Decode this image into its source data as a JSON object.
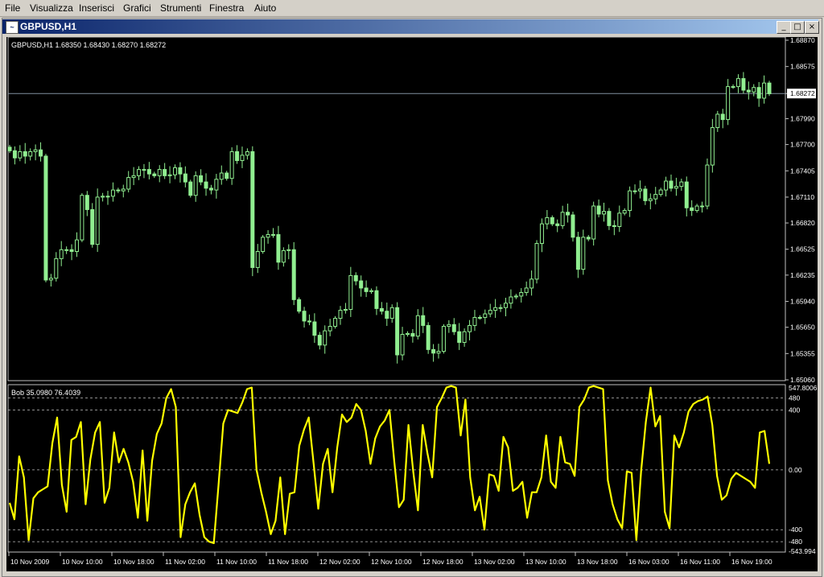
{
  "menu": {
    "items": [
      "File",
      "Visualizza",
      "Inserisci",
      "Grafici",
      "Strumenti",
      "Finestra",
      "Aiuto"
    ]
  },
  "window": {
    "title": "GBPUSD,H1",
    "minimize_label": "_",
    "maximize_label": "□",
    "close_label": "×"
  },
  "main_chart": {
    "header": "GBPUSD,H1  1.68350 1.68430 1.68270 1.68272",
    "current_price": "1.68272",
    "price_ticks": [
      "1.68870",
      "1.68575",
      "1.68272",
      "1.67990",
      "1.67700",
      "1.67405",
      "1.67110",
      "1.66820",
      "1.66525",
      "1.66235",
      "1.65940",
      "1.65650",
      "1.65355",
      "1.65060"
    ]
  },
  "indicator": {
    "header": "Bob 35.0980 76.4039",
    "ticks": [
      "547.8006",
      "480",
      "400",
      "0.00",
      "-400",
      "-480",
      "-543.994"
    ]
  },
  "time_axis": [
    "10 Nov 2009",
    "10 Nov 10:00",
    "10 Nov 18:00",
    "11 Nov 02:00",
    "11 Nov 10:00",
    "11 Nov 18:00",
    "12 Nov 02:00",
    "12 Nov 10:00",
    "12 Nov 18:00",
    "13 Nov 02:00",
    "13 Nov 10:00",
    "13 Nov 18:00",
    "16 Nov 03:00",
    "16 Nov 11:00",
    "16 Nov 19:00"
  ],
  "colors": {
    "candle": "#90ee90",
    "indicator": "#ffff00",
    "grid": "#c0c0c0",
    "title_bar": "#0a246a"
  },
  "chart_data": [
    {
      "type": "candlestick",
      "title": "GBPUSD,H1",
      "ylim": [
        1.6506,
        1.6887
      ],
      "close": [
        1.6763,
        1.6755,
        1.6762,
        1.6757,
        1.6762,
        1.6764,
        1.6757,
        1.6618,
        1.662,
        1.6642,
        1.6652,
        1.6652,
        1.665,
        1.6663,
        1.6713,
        1.6697,
        1.6658,
        1.6711,
        1.6712,
        1.6712,
        1.6719,
        1.6718,
        1.672,
        1.6733,
        1.6735,
        1.6742,
        1.6742,
        1.6737,
        1.6735,
        1.6742,
        1.6735,
        1.6736,
        1.6744,
        1.6737,
        1.6728,
        1.6713,
        1.6735,
        1.6728,
        1.6721,
        1.6719,
        1.6731,
        1.6738,
        1.6732,
        1.6762,
        1.6752,
        1.6758,
        1.6762,
        1.6632,
        1.665,
        1.6666,
        1.6669,
        1.6669,
        1.6638,
        1.6651,
        1.6652,
        1.6596,
        1.6583,
        1.6572,
        1.6571,
        1.6556,
        1.6545,
        1.6561,
        1.6566,
        1.6575,
        1.6584,
        1.6585,
        1.6623,
        1.6617,
        1.6609,
        1.6605,
        1.6606,
        1.6586,
        1.6583,
        1.6575,
        1.6587,
        1.6534,
        1.6557,
        1.6558,
        1.6555,
        1.6578,
        1.6567,
        1.654,
        1.6536,
        1.6538,
        1.6566,
        1.6568,
        1.656,
        1.6548,
        1.656,
        1.6567,
        1.6576,
        1.6576,
        1.658,
        1.6584,
        1.6587,
        1.6587,
        1.6592,
        1.6599,
        1.66,
        1.6604,
        1.6609,
        1.6619,
        1.6659,
        1.6681,
        1.6688,
        1.6681,
        1.6679,
        1.6694,
        1.6691,
        1.6666,
        1.663,
        1.6666,
        1.6664,
        1.6701,
        1.6692,
        1.6695,
        1.6679,
        1.6678,
        1.6693,
        1.6696,
        1.6718,
        1.6718,
        1.672,
        1.6707,
        1.6709,
        1.6714,
        1.6719,
        1.6729,
        1.6721,
        1.6723,
        1.6728,
        1.6699,
        1.6696,
        1.6701,
        1.6701,
        1.6747,
        1.6789,
        1.6804,
        1.6798,
        1.6835,
        1.6835,
        1.6844,
        1.6831,
        1.6829,
        1.6834,
        1.6822,
        1.6839,
        1.6827
      ]
    },
    {
      "type": "line",
      "title": "Bob",
      "ylim": [
        -543.994,
        547.8006
      ],
      "series": [
        {
          "values": [
            -220,
            -330,
            90,
            -50,
            -470,
            -190,
            -150,
            -130,
            -110,
            180,
            350,
            -100,
            -280,
            200,
            220,
            320,
            -230,
            70,
            250,
            320,
            -220,
            -120,
            250,
            50,
            140,
            50,
            -80,
            -320,
            130,
            -340,
            60,
            240,
            310,
            480,
            540,
            420,
            -450,
            -230,
            -150,
            -90,
            -300,
            -450,
            -480,
            -490,
            -100,
            310,
            400,
            390,
            380,
            450,
            540,
            550,
            0,
            -150,
            -280,
            -430,
            -340,
            -50,
            -430,
            -160,
            -150,
            160,
            270,
            350,
            50,
            -260,
            40,
            140,
            -150,
            150,
            370,
            320,
            350,
            440,
            400,
            260,
            40,
            210,
            290,
            330,
            400,
            60,
            -250,
            -200,
            300,
            -10,
            -270,
            300,
            110,
            -50,
            420,
            480,
            550,
            560,
            550,
            230,
            470,
            -50,
            -270,
            -180,
            -400,
            -30,
            -40,
            -140,
            220,
            150,
            -140,
            -120,
            -80,
            -320,
            -150,
            -150,
            -50,
            230,
            -80,
            -120,
            220,
            50,
            40,
            -40,
            420,
            470,
            550,
            560,
            550,
            540,
            -70,
            -230,
            -330,
            -390,
            -10,
            -20,
            -470,
            -10,
            320,
            550,
            290,
            360,
            -280,
            -390,
            230,
            150,
            250,
            390,
            440,
            460,
            470,
            490,
            300,
            -40,
            -200,
            -170,
            -60,
            -20,
            -40,
            -60,
            -80,
            -120,
            250,
            260,
            40
          ]
        }
      ]
    }
  ]
}
